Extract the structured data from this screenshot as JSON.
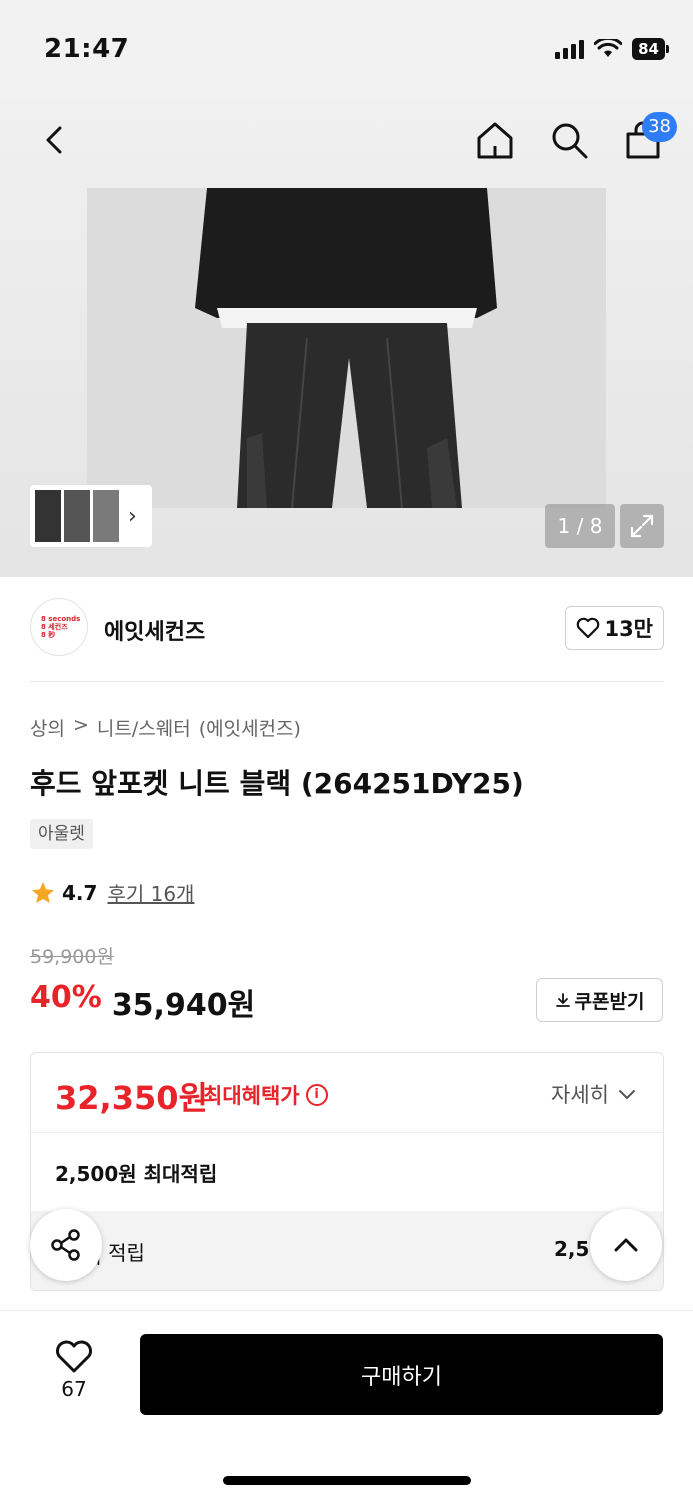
{
  "status_bar": {
    "time": "21:47",
    "battery": "84"
  },
  "header": {
    "cart_count": "38"
  },
  "gallery": {
    "page_indicator": "1 / 8"
  },
  "brand": {
    "logo_lines": [
      "8 seconds",
      "8 세컨즈",
      "8 秒"
    ],
    "name": "에잇세컨즈",
    "follow_count": "13만"
  },
  "breadcrumb": {
    "level1": "상의",
    "separator": ">",
    "level2": "니트/스웨터",
    "brand_tag": "(에잇세컨즈)"
  },
  "product": {
    "title": "후드 앞포켓 니트 블랙 (264251DY25)",
    "tag": "아울렛",
    "rating": "4.7",
    "reviews": "후기 16개",
    "original_price": "59,900원",
    "discount": "40%",
    "sale_price": "35,940원",
    "coupon_label": "쿠폰받기"
  },
  "benefits": {
    "best_price": "32,350원",
    "best_label": "최대혜택가",
    "details_label": "자세히",
    "points": "2,500원 최대적립",
    "earn_label": "| 적립",
    "earn_value": "2,5"
  },
  "bottom": {
    "like_count": "67",
    "buy_label": "구매하기"
  },
  "colors": {
    "accent_red": "#e8242a",
    "badge_blue": "#2f7df6",
    "buy_black": "#000000"
  }
}
